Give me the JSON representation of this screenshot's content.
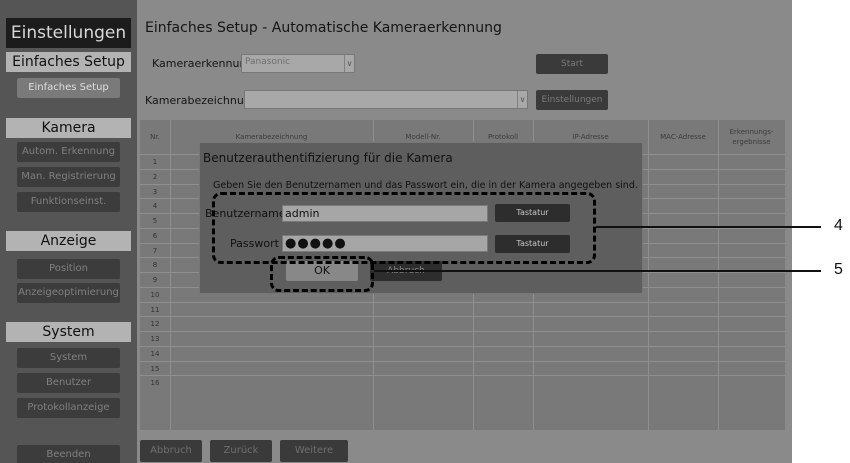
{
  "sidebar": {
    "app_title": "Einstellungen",
    "sections": [
      {
        "header": "Einfaches Setup",
        "items": [
          "Einfaches Setup"
        ]
      },
      {
        "header": "Kamera",
        "items": [
          "Autom. Erkennung",
          "Man. Registrierung",
          "Funktionseinst."
        ]
      },
      {
        "header": "Anzeige",
        "items": [
          "Position",
          "Anzeigeoptimierung"
        ]
      },
      {
        "header": "System",
        "items": [
          "System",
          "Benutzer",
          "Protokollanzeige"
        ]
      }
    ],
    "quit": "Beenden"
  },
  "main": {
    "title": "Einfaches Setup - Automatische Kameraerkennung",
    "camera_detection_label": "Kameraerkennung",
    "camera_detection_value": "Panasonic",
    "start_button": "Start",
    "camera_name_label": "Kamerabezeichnung",
    "camera_name_value": "",
    "settings_button": "Einstellungen"
  },
  "table": {
    "headers": {
      "nr": "Nr.",
      "name": "Kamerabezeichnung",
      "model": "Modell-Nr.",
      "protocol": "Protokoll",
      "ip": "IP-Adresse",
      "mac": "MAC-Adresse",
      "results": "Erkennungs-ergebnisse"
    },
    "row_numbers": [
      "1",
      "2",
      "3",
      "4",
      "5",
      "6",
      "7",
      "8",
      "9",
      "10",
      "11",
      "12",
      "13",
      "14",
      "15",
      "16"
    ]
  },
  "bottom": {
    "cancel": "Abbruch",
    "back": "Zurück",
    "next": "Weitere"
  },
  "dialog": {
    "title": "Benutzerauthentifizierung für die Kamera",
    "instruction": "Geben Sie den Benutzernamen und das Passwort ein, die in der Kamera angegeben sind.",
    "username_label": "Benutzername :",
    "username_value": "admin",
    "password_label": "Passwort :",
    "password_value": "●●●●●",
    "keyboard_button": "Tastatur",
    "ok_button": "OK",
    "cancel_button": "Abbruch"
  },
  "callouts": [
    "4",
    "5"
  ]
}
